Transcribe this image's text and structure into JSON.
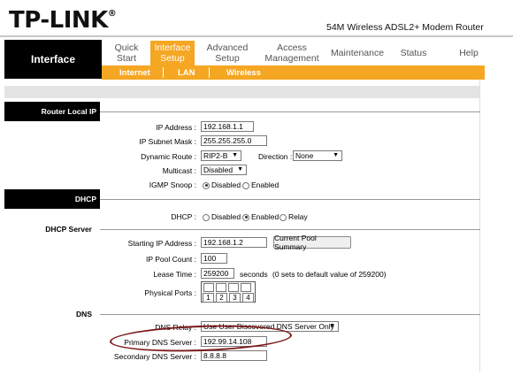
{
  "brand": {
    "logo": "TP-LINK",
    "logo_mark": "®",
    "model": "54M Wireless ADSL2+ Modem Router"
  },
  "nav": {
    "section_title": "Interface",
    "items": [
      {
        "line1": "Quick",
        "line2": "Start"
      },
      {
        "line1": "Interface",
        "line2": "Setup",
        "active": true
      },
      {
        "line1": "Advanced",
        "line2": "Setup"
      },
      {
        "line1": "Access",
        "line2": "Management"
      },
      {
        "line1": "Maintenance",
        "line2": ""
      },
      {
        "line1": "Status",
        "line2": ""
      },
      {
        "line1": "Help",
        "line2": ""
      }
    ],
    "sub": [
      "Internet",
      "LAN",
      "Wireless"
    ]
  },
  "router_local_ip": {
    "section": "Router Local IP",
    "ip_label": "IP Address :",
    "ip_value": "192.168.1.1",
    "mask_label": "IP Subnet Mask :",
    "mask_value": "255.255.255.0",
    "dyn_label": "Dynamic Route :",
    "dyn_value": "RIP2-B",
    "dir_label": "Direction :",
    "dir_value": "None",
    "multicast_label": "Multicast :",
    "multicast_value": "Disabled",
    "igmp_label": "IGMP Snoop :",
    "igmp_disabled": "Disabled",
    "igmp_enabled": "Enabled"
  },
  "dhcp": {
    "section": "DHCP",
    "label": "DHCP :",
    "opt_disabled": "Disabled",
    "opt_enabled": "Enabled",
    "opt_relay": "Relay"
  },
  "dhcp_server": {
    "section": "DHCP Server",
    "start_label": "Starting IP Address :",
    "start_value": "192.168.1.2",
    "pool_button": "Current Pool Summary",
    "count_label": "IP Pool Count :",
    "count_value": "100",
    "lease_label": "Lease Time :",
    "lease_value": "259200",
    "lease_unit": "seconds",
    "lease_note": "(0 sets to default value of 259200)",
    "ports_label": "Physical Ports :",
    "ports": [
      "1",
      "2",
      "3",
      "4"
    ]
  },
  "dns": {
    "section": "DNS",
    "relay_label": "DNS Relay :",
    "relay_value": "Use User Discovered DNS Server Only",
    "primary_label": "Primary DNS Server :",
    "primary_value": "192.99.14.108",
    "secondary_label": "Secondary DNS Server :",
    "secondary_value": "8.8.8.8"
  },
  "colors": {
    "accent": "#f5a623",
    "header_black": "#000000",
    "annotation": "#7b1a1a"
  }
}
